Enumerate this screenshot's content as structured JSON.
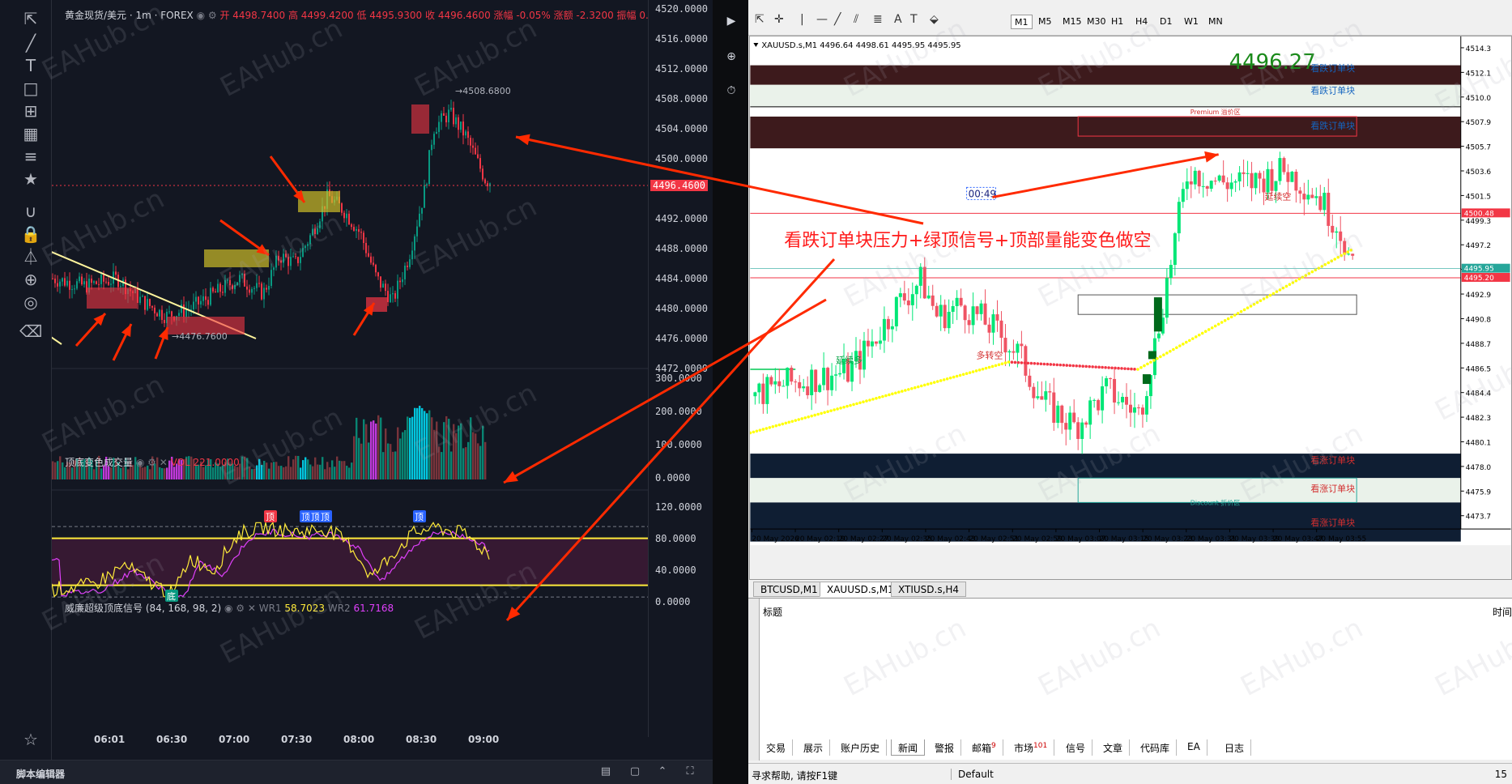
{
  "left": {
    "legend": {
      "symbol": "黄金现货/美元 · 1m · FOREX",
      "ohlc": "开 4498.7400  高 4499.4200  低 4495.9300  收 4496.4600  涨幅 -0.05%  涨额 -2.3200  振幅 0.08%"
    },
    "price_axis": [
      "4520.0000",
      "4516.0000",
      "4512.0000",
      "4508.0000",
      "4504.0000",
      "4500.0000",
      "4496.4600",
      "4492.0000",
      "4488.0000",
      "4484.0000",
      "4480.0000",
      "4476.0000",
      "4472.0000"
    ],
    "current_price": "4496.4600",
    "annotations": {
      "high": "→4508.6800",
      "low": "→4476.7600"
    },
    "volume_pane": {
      "title": "顶底变色成交量",
      "vol_label": "VOL",
      "vol_value": "221.0000",
      "axis": [
        "300.0000",
        "200.0000",
        "100.0000",
        "0.0000"
      ]
    },
    "osc_pane": {
      "title": "威廉超级顶底信号 (84, 168, 98, 2)",
      "wr1_label": "WR1",
      "wr1_value": "58.7023",
      "wr2_label": "WR2",
      "wr2_value": "61.7168",
      "axis": [
        "120.0000",
        "80.0000",
        "40.0000",
        "0.0000"
      ],
      "top_label": "顶",
      "bottom_label": "底"
    },
    "time_axis": [
      "06:01",
      "06:30",
      "07:00",
      "07:30",
      "08:00",
      "08:30",
      "09:00"
    ],
    "bottom_bar_label": "脚本编辑器"
  },
  "right": {
    "timeframes": [
      "M1",
      "M5",
      "M15",
      "M30",
      "H1",
      "H4",
      "D1",
      "W1",
      "MN"
    ],
    "chart_header": "XAUUSD.s,M1  4496.64 4498.61 4495.95 4495.95",
    "big_price": "4496.27",
    "timer": "00:49",
    "annotation": "看跌订单块压力+绿顶信号+顶部量能变色做空",
    "labels": {
      "bear_ob": "看跌订单块",
      "bull_ob": "看涨订单块",
      "continue_long": "延续多",
      "continue_short": "延续空",
      "long_to_short": "多转空",
      "premium": "Premium 溢价区",
      "discount": "Discount 折价区"
    },
    "price_axis": [
      "4514.3",
      "4512.1",
      "4510.0",
      "4507.9",
      "4505.7",
      "4503.6",
      "4501.5",
      "4499.3",
      "4497.2",
      "4495.1",
      "4492.9",
      "4490.8",
      "4488.7",
      "4486.5",
      "4484.4",
      "4482.3",
      "4480.1",
      "4478.0",
      "4475.9",
      "4473.7"
    ],
    "price_tags": {
      "red": "4500.48",
      "current": "4495.95",
      "low_red": "4495.20"
    },
    "time_axis": [
      "20 May 2026",
      "20 May 02:19",
      "20 May 02:27",
      "20 May 02:35",
      "20 May 02:43",
      "20 May 02:51",
      "20 May 02:59",
      "20 May 03:07",
      "20 May 03:15",
      "20 May 03:23",
      "20 May 03:31",
      "20 May 03:39",
      "20 May 03:47",
      "20 May 03:55"
    ],
    "chart_tabs": [
      "BTCUSD,M1",
      "XAUUSD.s,M1",
      "XTIUSD.s,H4"
    ],
    "toolbox_header": "标题",
    "toolbox_time": "时间",
    "toolbox_tabs": [
      {
        "label": "交易"
      },
      {
        "label": "展示"
      },
      {
        "label": "账户历史"
      },
      {
        "label": "新闻"
      },
      {
        "label": "警报"
      },
      {
        "label": "邮箱",
        "badge": "9"
      },
      {
        "label": "市场",
        "badge": "101"
      },
      {
        "label": "信号"
      },
      {
        "label": "文章"
      },
      {
        "label": "代码库"
      },
      {
        "label": "EA"
      },
      {
        "label": "日志"
      }
    ],
    "status_help": "寻求帮助, 请按F1键",
    "status_profile": "Default",
    "status_right": "15"
  },
  "watermark": "EAHub.cn",
  "colors": {
    "up": "#089981",
    "down": "#f23645",
    "tv_bg": "#131722",
    "mt_up": "#00e676",
    "mt_down": "#ef5363",
    "ma": "#ffff00",
    "arrow": "#ff2a00",
    "bear_ob": "#3d1a1c",
    "bull_ob": "#0f1e33"
  }
}
